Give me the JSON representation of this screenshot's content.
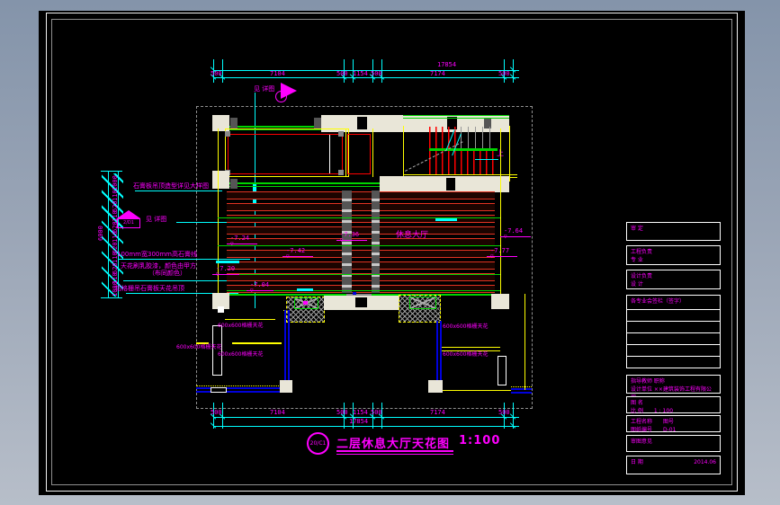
{
  "dims": {
    "main": {
      "total": "17854",
      "segments": [
        "500",
        "7104",
        "500",
        "1154",
        "500",
        "7174",
        "500"
      ]
    },
    "left": {
      "total": "6000",
      "segments": [
        "1000",
        "110",
        "620",
        "110",
        "620",
        "110",
        "620",
        "110",
        "620",
        "110",
        "1000"
      ]
    }
  },
  "annotations": {
    "see_detail": "见 详图",
    "marker_ref": "2/D1",
    "note_top": "石膏板吊顶造型详见大样图",
    "note_band": "100mm宽300mm高石膏线",
    "note_paint1": "天花刷乳胶漆，颜色由甲方",
    "note_paint2": "（布同颜色）",
    "note_grille": "铝格栅吊石膏板天花吊顶",
    "hall": "休息大厅",
    "up": "上",
    "grid": "600x600格栅天花"
  },
  "elevations": [
    {
      "value": "-7.24"
    },
    {
      "value": "-7.36"
    },
    {
      "value": "-7.64"
    },
    {
      "value": "-7.42"
    },
    {
      "value": "-7.77"
    },
    {
      "value": "-7.20"
    },
    {
      "value": "-7.04"
    }
  ],
  "title": {
    "ref": "20/C1",
    "name": "二层休息大厅天花图",
    "scale": "1:100"
  },
  "titleblock": {
    "b1": "审 定",
    "b2a": "工程负责",
    "b2b": "专 业",
    "b3a": "设计负责",
    "b3b": "设 计",
    "t_header": "各专业会签栏（签字）",
    "b5a": "指导教师  职称",
    "b5b": "设计单位  ××建筑装饰工程有限公司",
    "b6a": "图 名",
    "b6b": "比 例　　1 : 100",
    "b7a": "工程名称　　图号",
    "b7b": "图纸编号　　D-01",
    "b8": "审图意见",
    "b9a": "日 期",
    "b9b": "2014.06"
  },
  "colors": {
    "dim": "#00ffff",
    "text": "#ff00ff",
    "line_green": "#00d400",
    "line_red": "#ff0000",
    "wall_blue": "#0000dd",
    "wall_yellow": "#ffff00"
  }
}
